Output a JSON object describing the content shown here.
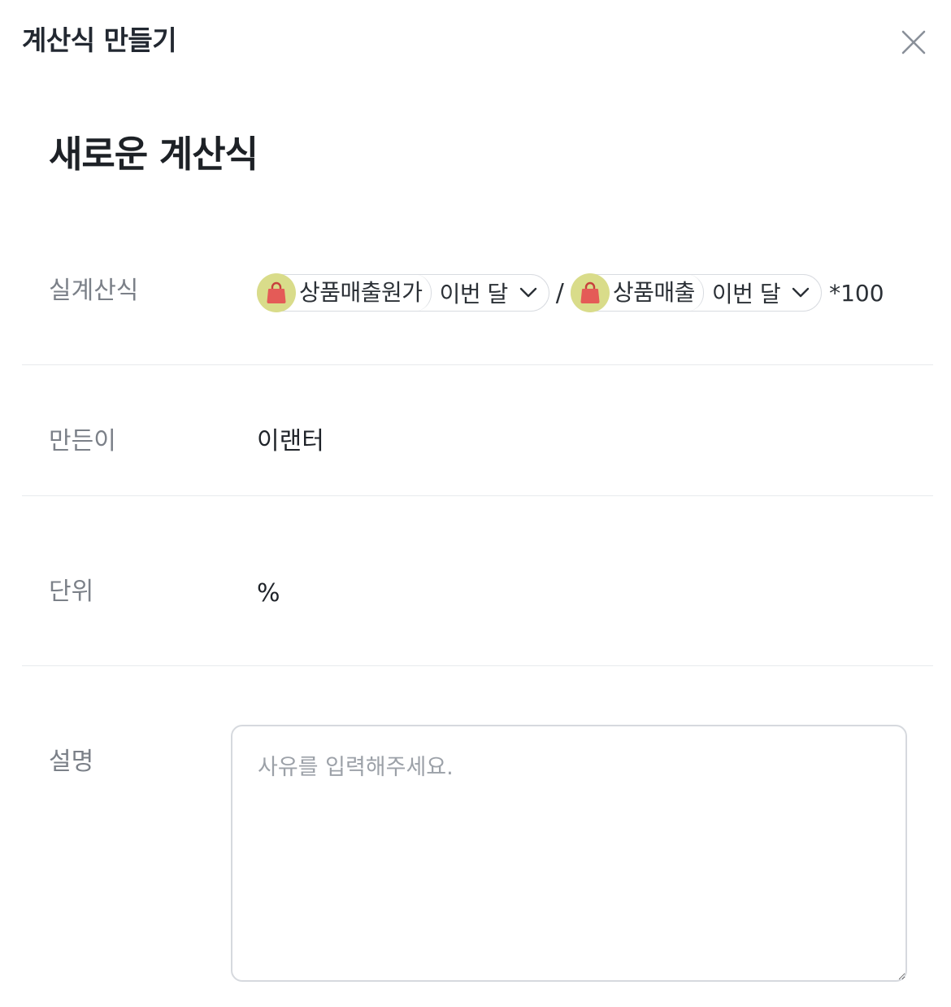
{
  "modal": {
    "title": "계산식 만들기",
    "close_icon": "close-icon"
  },
  "formula": {
    "name": "새로운 계산식"
  },
  "rows": {
    "expression_label": "실계산식",
    "creator_label": "만든이",
    "creator_value": "이랜터",
    "unit_label": "단위",
    "unit_value": "%",
    "description_label": "설명",
    "description_placeholder": "사유를 입력해주세요.",
    "description_value": ""
  },
  "expression": {
    "terms": [
      {
        "metric": "상품매출원가",
        "period": "이번 달",
        "icon": "shopping-bag-icon"
      },
      {
        "metric": "상품매출",
        "period": "이번 달",
        "icon": "shopping-bag-icon"
      }
    ],
    "operator": "/",
    "suffix": "*100"
  },
  "colors": {
    "avatar_bg": "#d9dc8a",
    "bag_icon": "#e45b57",
    "label": "#7b8088"
  }
}
